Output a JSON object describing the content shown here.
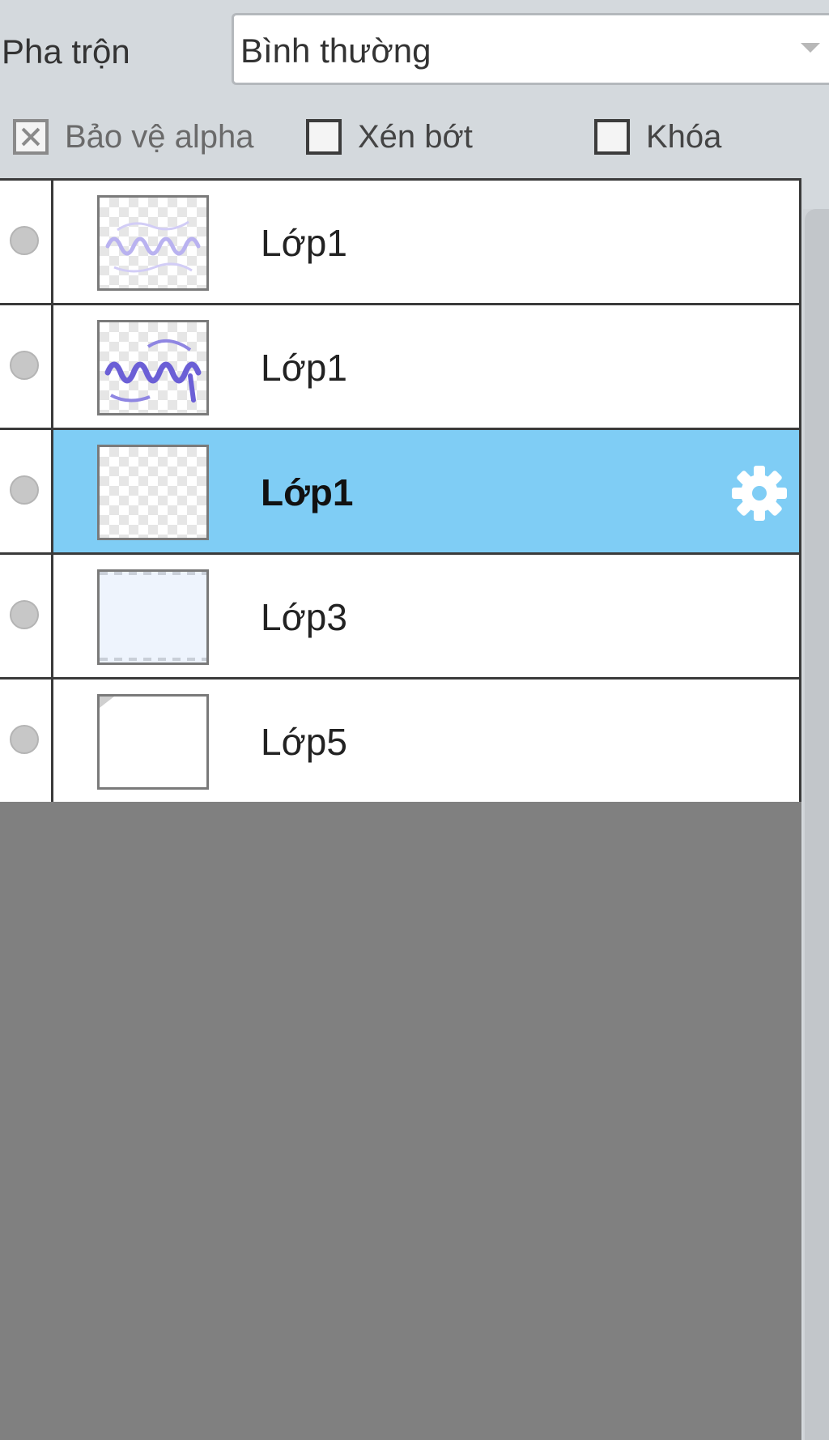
{
  "blend": {
    "label": "Pha trộn",
    "value": "Bình thường"
  },
  "options": [
    {
      "label": "Bảo vệ alpha",
      "checked": false,
      "disabled": true
    },
    {
      "label": "Xén bớt",
      "checked": false,
      "disabled": false
    },
    {
      "label": "Khóa",
      "checked": false,
      "disabled": false
    }
  ],
  "layers": [
    {
      "name": "Lớp1",
      "selected": false,
      "thumbnail": "faint-lettering"
    },
    {
      "name": "Lớp1",
      "selected": false,
      "thumbnail": "lettering"
    },
    {
      "name": "Lớp1",
      "selected": true,
      "thumbnail": "transparent",
      "settings_icon": "gear-icon"
    },
    {
      "name": "Lớp3",
      "selected": false,
      "thumbnail": "pale-blue-fill"
    },
    {
      "name": "Lớp5",
      "selected": false,
      "thumbnail": "white-fill"
    }
  ],
  "colors": {
    "selected_row": "#7fcdf5",
    "empty_area": "#808080",
    "panel_bg": "#d4d9dd",
    "ink": "#6b5fd6"
  }
}
